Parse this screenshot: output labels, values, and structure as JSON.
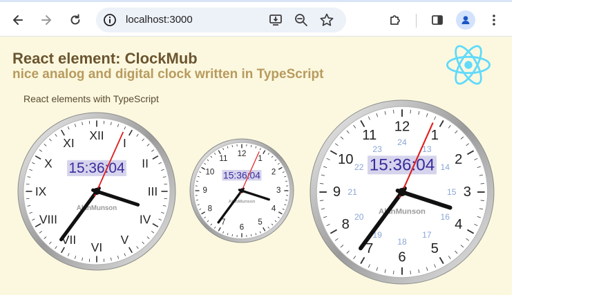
{
  "browser": {
    "url": "localhost:3000",
    "colors": {
      "toolbar": "#ffffff",
      "omnibox": "#edf1f8",
      "icon": "#3c3c3c"
    }
  },
  "page": {
    "title": "React element: ClockMub",
    "subtitle": "nice analog and digital clock written in TypeScript",
    "section_label": "React elements with TypeScript",
    "colors": {
      "background": "#fbf8df",
      "title": "#6b5530",
      "subtitle": "#b89a5e",
      "react": "#61dafb"
    }
  },
  "clocks": [
    {
      "digital": "15:36:04",
      "brand": "AlanMunson",
      "numerals": [
        "XII",
        "I",
        "II",
        "III",
        "IV",
        "V",
        "VI",
        "VII",
        "VIII",
        "IX",
        "X",
        "XI"
      ],
      "hour24": [],
      "show_numerals": true
    },
    {
      "digital": "15:36:04",
      "brand": "AlanMunson",
      "numerals": [
        "12",
        "1",
        "2",
        "3",
        "4",
        "5",
        "6",
        "7",
        "8",
        "9",
        "10",
        "11"
      ],
      "hour24": [],
      "show_numerals": true
    },
    {
      "digital": "15:36:04",
      "brand": "AlanMunson",
      "numerals": [
        "12",
        "1",
        "2",
        "3",
        "4",
        "5",
        "6",
        "7",
        "8",
        "9",
        "10",
        "11"
      ],
      "hour24": [
        "24",
        "13",
        "14",
        "15",
        "16",
        "17",
        "18",
        "19",
        "20",
        "21",
        "22",
        "23"
      ],
      "show_numerals": true
    }
  ],
  "time": {
    "hours": 15,
    "minutes": 36,
    "seconds": 4
  }
}
